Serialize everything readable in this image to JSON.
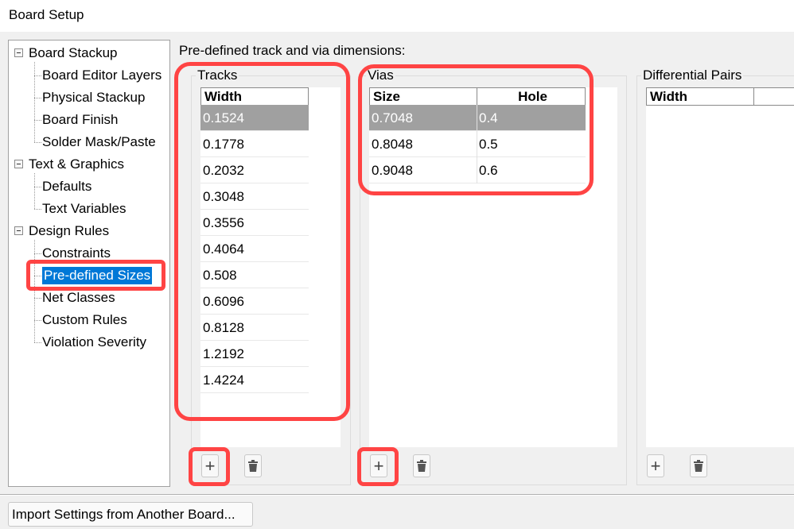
{
  "window": {
    "title": "Board Setup"
  },
  "tree": [
    {
      "label": "Board Stackup",
      "level": 0
    },
    {
      "label": "Board Editor Layers",
      "level": 1
    },
    {
      "label": "Physical Stackup",
      "level": 1
    },
    {
      "label": "Board Finish",
      "level": 1
    },
    {
      "label": "Solder Mask/Paste",
      "level": 1
    },
    {
      "label": "Text & Graphics",
      "level": 0
    },
    {
      "label": "Defaults",
      "level": 1
    },
    {
      "label": "Text Variables",
      "level": 1
    },
    {
      "label": "Design Rules",
      "level": 0
    },
    {
      "label": "Constraints",
      "level": 1
    },
    {
      "label": "Pre-defined Sizes",
      "level": 1,
      "selected": true
    },
    {
      "label": "Net Classes",
      "level": 1
    },
    {
      "label": "Custom Rules",
      "level": 1
    },
    {
      "label": "Violation Severity",
      "level": 1
    }
  ],
  "main": {
    "heading": "Pre-defined track and via dimensions:",
    "tracks": {
      "label": "Tracks",
      "columns": [
        "Width"
      ],
      "rows": [
        "0.1524",
        "0.1778",
        "0.2032",
        "0.3048",
        "0.3556",
        "0.4064",
        "0.508",
        "0.6096",
        "0.8128",
        "1.2192",
        "1.4224"
      ]
    },
    "vias": {
      "label": "Vias",
      "columns": [
        "Size",
        "Hole"
      ],
      "rows": [
        [
          "0.7048",
          "0.4"
        ],
        [
          "0.8048",
          "0.5"
        ],
        [
          "0.9048",
          "0.6"
        ]
      ]
    },
    "diff_pairs": {
      "label": "Differential Pairs",
      "columns": [
        "Width",
        ""
      ],
      "rows": []
    }
  },
  "footer": {
    "import_label": "Import Settings from Another Board..."
  },
  "colors": {
    "highlight": "#ff4444",
    "selection": "#0078d7",
    "selected_row": "#a0a0a0"
  }
}
